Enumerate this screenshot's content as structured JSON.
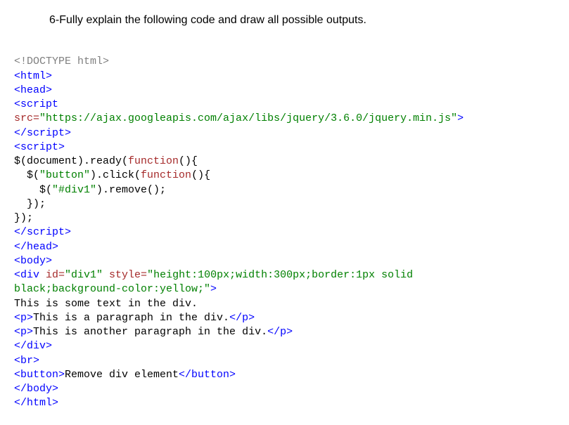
{
  "question": "6-Fully explain the following code and draw all possible outputs.",
  "code": {
    "l1": {
      "a": "<!DOCTYPE html>"
    },
    "l2": {
      "a": "<html>"
    },
    "l3": {
      "a": "<head>"
    },
    "l4": {
      "a": "<script"
    },
    "l5": {
      "a": "src=",
      "b": "\"https://ajax.googleapis.com/ajax/libs/jquery/3.6.0/jquery.min.js\"",
      "c": ">"
    },
    "l6": {
      "a": "</",
      "b": "script",
      "c": ">"
    },
    "l7": {
      "a": "<script>"
    },
    "l8": {
      "a": "$(document).ready(",
      "b": "function",
      "c": "(){"
    },
    "l9": {
      "a": "  $(",
      "b": "\"button\"",
      "c": ").click(",
      "d": "function",
      "e": "(){"
    },
    "l10": {
      "a": "    $(",
      "b": "\"#div1\"",
      "c": ").remove();"
    },
    "l11": {
      "a": "  });"
    },
    "l12": {
      "a": "});"
    },
    "l13": {
      "a": "</",
      "b": "script",
      "c": ">"
    },
    "l14": {
      "a": "</head>"
    },
    "l15": {
      "a": "<body>"
    },
    "l16": {
      "a": "<div",
      "b": " id=",
      "c": "\"div1\"",
      "d": " style=",
      "e": "\"height:100px;width:300px;border:1px solid ",
      "f": "black;background-color:yellow;\"",
      "g": ">"
    },
    "l17": {
      "a": "This is some text in the div."
    },
    "l18": {
      "a": "<p>",
      "b": "This is a paragraph in the div.",
      "c": "</p>"
    },
    "l19": {
      "a": "<p>",
      "b": "This is another paragraph in the div.",
      "c": "</p>"
    },
    "l20": {
      "a": "</div>"
    },
    "l21": {
      "a": "<br>"
    },
    "l22": {
      "a": "<button>",
      "b": "Remove div element",
      "c": "</button>"
    },
    "l23": {
      "a": "</body>"
    },
    "l24": {
      "a": "</html>"
    }
  }
}
